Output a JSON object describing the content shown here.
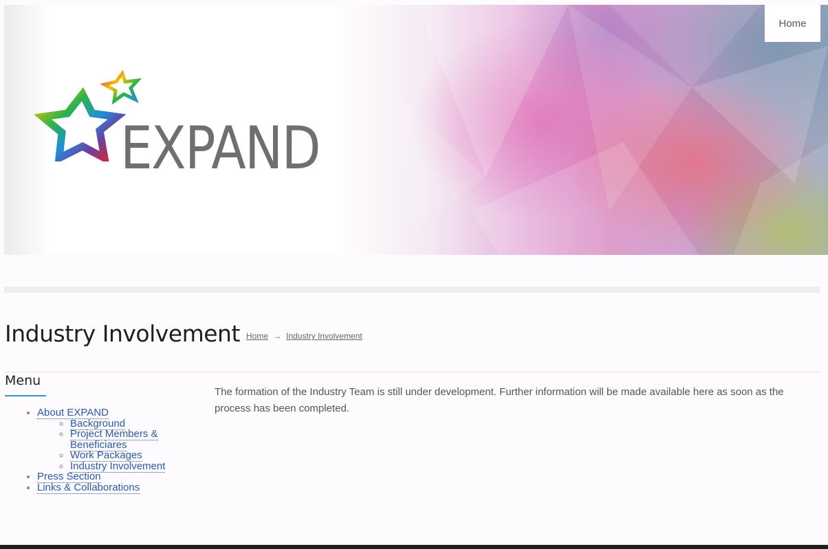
{
  "header": {
    "logo_text": "EXPAND",
    "nav": {
      "home": "Home"
    }
  },
  "page": {
    "title": "Industry Involvement",
    "breadcrumb": {
      "home": "Home",
      "separator": "→",
      "current": "Industry Involvement"
    }
  },
  "menu": {
    "title": "Menu",
    "items": [
      {
        "label": "About EXPAND",
        "children": [
          {
            "label": "Background"
          },
          {
            "label": "Project Members & Beneficiares"
          },
          {
            "label": "Work Packages"
          },
          {
            "label": "Industry Involvement"
          }
        ]
      },
      {
        "label": "Press Section"
      },
      {
        "label": "Links & Collaborations"
      }
    ]
  },
  "content": {
    "text": "The formation of the Industry Team is still under development. Further information will be made available here as soon as the process has been completed."
  },
  "colors": {
    "link": "#2c5aa8",
    "menu_accent": "#3a8fd4",
    "logo_gray": "#6f6f71",
    "footer": "#1e1e1e"
  }
}
